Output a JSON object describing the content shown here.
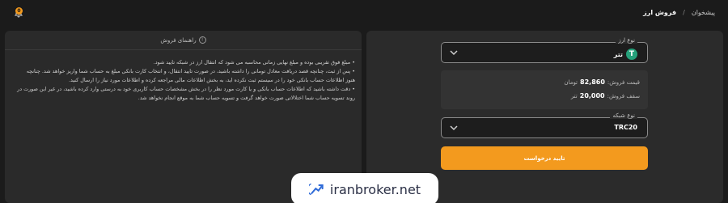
{
  "breadcrumb": {
    "parent": "پیشخوان",
    "separator": "/",
    "current": "فروش ارز"
  },
  "notifications": {
    "badge": "0"
  },
  "form": {
    "currency_field": {
      "legend": "نوع ارز",
      "value": "تتر",
      "icon": "tether-icon"
    },
    "price": {
      "label": "قیمت فروش:",
      "value": "82,860",
      "unit": "تومان"
    },
    "limit": {
      "label": "سقف فروش:",
      "value": "20,000",
      "unit": "تتر"
    },
    "network_field": {
      "legend": "نوع شبکه",
      "value": "TRC20"
    },
    "submit_label": "تایید درخواست"
  },
  "guide": {
    "title": "راهنمای فروش",
    "lines": [
      "• مبلغ فوق تقریبی بوده و مبلغ نهایی زمانی محاسبه می شود که انتقال ارز در شبکه تایید شود.",
      "• پس از ثبت، چنانچه قصد دریافت معادل تومانی را داشته باشید، در صورت تایید انتقال، و انتخاب کارت بانکی مبلغ به حساب شما واریز خواهد شد. چنانچه",
      "هنوز اطلاعات حساب بانکی خود را در سیستم ثبت نکرده اید، به بخش اطلاعات مالی مراجعه کرده و اطلاعات مورد نیاز را ارسال کنید.",
      "• دقت داشته باشید که اطلاعات حساب بانکی و یا کارت مورد نظر را در بخش مشخصات حساب کاربری خود به درستی وارد کرده باشید، در غیر این صورت در",
      "روند تسویه حساب شما اختلالاتی صورت خواهد گرفت و تسویه حساب شما به موقع انجام نخواهد شد."
    ]
  },
  "watermark": {
    "text": "iranbroker.net"
  },
  "colors": {
    "accent": "#f39a1e",
    "tether": "#26a17b",
    "panel": "#2b2b2b",
    "background": "#1b1b1b"
  }
}
